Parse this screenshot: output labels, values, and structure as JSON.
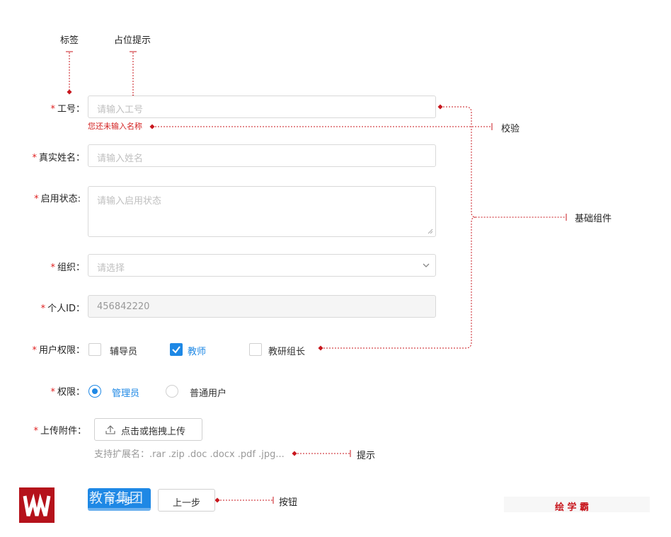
{
  "annotations": {
    "label": "标签",
    "placeholder": "占位提示",
    "validation": "校验",
    "base_components": "基础组件",
    "hint": "提示",
    "button": "按钮"
  },
  "form": {
    "required_mark": "*",
    "employee_id": {
      "label": "工号：",
      "placeholder": "请输入工号",
      "error": "您还未输入名称"
    },
    "real_name": {
      "label": "真实姓名：",
      "placeholder": "请输入姓名"
    },
    "status": {
      "label": "启用状态:",
      "placeholder": "请输入启用状态"
    },
    "organization": {
      "label": "组织：",
      "placeholder": "请选择"
    },
    "personal_id": {
      "label": "个人ID：",
      "value": "456842220"
    },
    "user_permissions": {
      "label": "用户权限：",
      "options": [
        {
          "label": "辅导员",
          "checked": false
        },
        {
          "label": "教师",
          "checked": true
        },
        {
          "label": "教研组长",
          "checked": false
        }
      ]
    },
    "permission": {
      "label": "权限：",
      "options": [
        {
          "label": "管理员",
          "selected": true
        },
        {
          "label": "普通用户",
          "selected": false
        }
      ]
    },
    "upload": {
      "label": "上传附件：",
      "button": "点击或拖拽上传",
      "hint": "支持扩展名：.rar .zip .doc .docx .pdf .jpg..."
    }
  },
  "buttons": {
    "primary": "下一步",
    "secondary": "上一步"
  },
  "overlay": {
    "watermark": "教育集团",
    "brand": "绘 学 霸"
  },
  "colors": {
    "accent": "#1e88e5",
    "required": "#e02020",
    "annotation": "#c8171e",
    "logo": "#b5121b"
  }
}
